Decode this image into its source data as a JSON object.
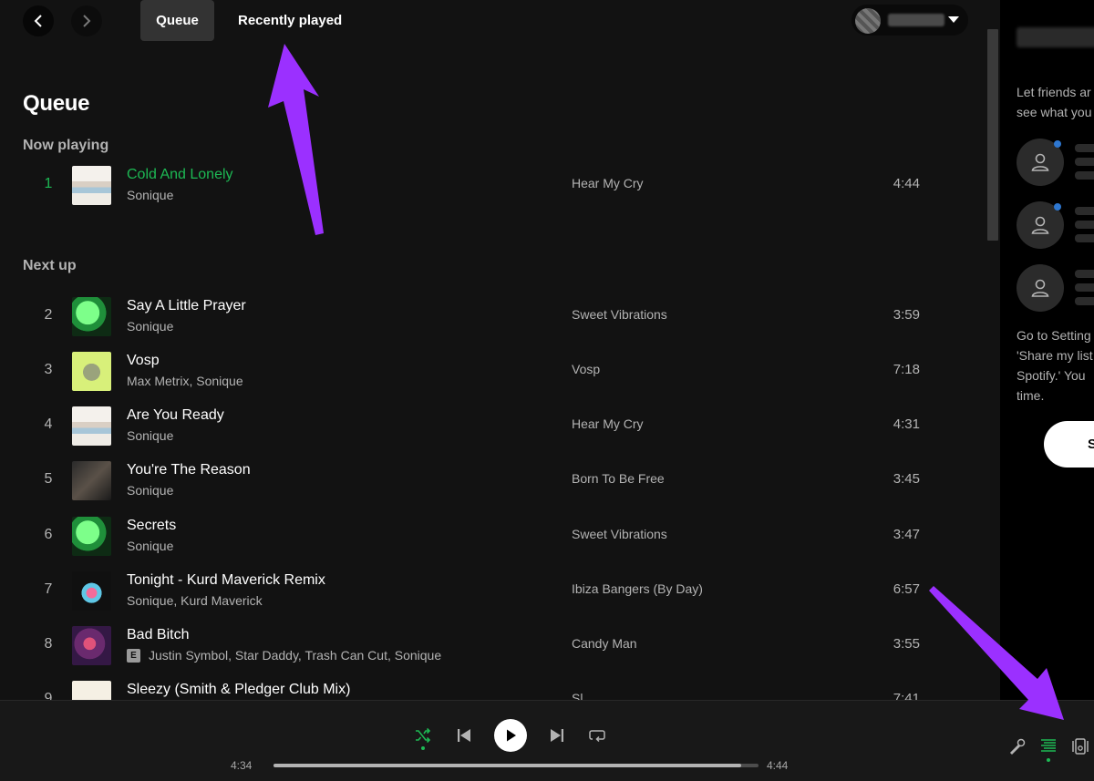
{
  "nav": {
    "back": "back",
    "forward": "forward"
  },
  "tabs": [
    {
      "label": "Queue",
      "active": true
    },
    {
      "label": "Recently played",
      "active": false
    }
  ],
  "page_title": "Queue",
  "now_playing_heading": "Now playing",
  "next_up_heading": "Next up",
  "now_playing": {
    "num": "1",
    "title": "Cold And Lonely",
    "artist": "Sonique",
    "album": "Hear My Cry",
    "duration": "4:44",
    "art": "art-hear"
  },
  "next_up": [
    {
      "num": "2",
      "title": "Say A Little Prayer",
      "artist": "Sonique",
      "album": "Sweet Vibrations",
      "duration": "3:59",
      "art": "art-sweet",
      "explicit": false
    },
    {
      "num": "3",
      "title": "Vosp",
      "artist": "Max Metrix, Sonique",
      "album": "Vosp",
      "duration": "7:18",
      "art": "art-vosp",
      "explicit": false
    },
    {
      "num": "4",
      "title": "Are You Ready",
      "artist": "Sonique",
      "album": "Hear My Cry",
      "duration": "4:31",
      "art": "art-hear",
      "explicit": false
    },
    {
      "num": "5",
      "title": "You're The Reason",
      "artist": "Sonique",
      "album": "Born To Be Free",
      "duration": "3:45",
      "art": "art-born",
      "explicit": false
    },
    {
      "num": "6",
      "title": "Secrets",
      "artist": "Sonique",
      "album": "Sweet Vibrations",
      "duration": "3:47",
      "art": "art-sweet",
      "explicit": false
    },
    {
      "num": "7",
      "title": "Tonight - Kurd Maverick Remix",
      "artist": "Sonique, Kurd Maverick",
      "album": "Ibiza Bangers (By Day)",
      "duration": "6:57",
      "art": "art-ibiza",
      "explicit": false
    },
    {
      "num": "8",
      "title": "Bad Bitch",
      "artist": "Justin Symbol, Star Daddy, Trash Can Cut, Sonique",
      "album": "Candy Man",
      "duration": "3:55",
      "art": "art-candy",
      "explicit": true,
      "explicit_label": "E"
    },
    {
      "num": "9",
      "title": "Sleezy (Smith & Pledger Club Mix)",
      "artist": "",
      "album": "Sl",
      "duration": "7:41",
      "art": "art-sleezy",
      "explicit": false
    }
  ],
  "friends": {
    "intro": "Let friends ar\nsee what you",
    "hint": "Go to Setting\n'Share my list\nSpotify.' You\ntime.",
    "button": "S"
  },
  "player": {
    "current_time": "4:34",
    "total_time": "4:44",
    "progress_fraction": 0.9648,
    "shuffle_active": true,
    "queue_active": true
  },
  "colors": {
    "accent": "#1db954",
    "background": "#121212",
    "annotation": "#9b30ff"
  },
  "icons": [
    "chevron-left-icon",
    "chevron-right-icon",
    "caret-down-icon",
    "user-icon",
    "shuffle-icon",
    "skip-back-icon",
    "play-icon",
    "skip-forward-icon",
    "repeat-icon",
    "microphone-icon",
    "queue-icon",
    "device-icon"
  ]
}
